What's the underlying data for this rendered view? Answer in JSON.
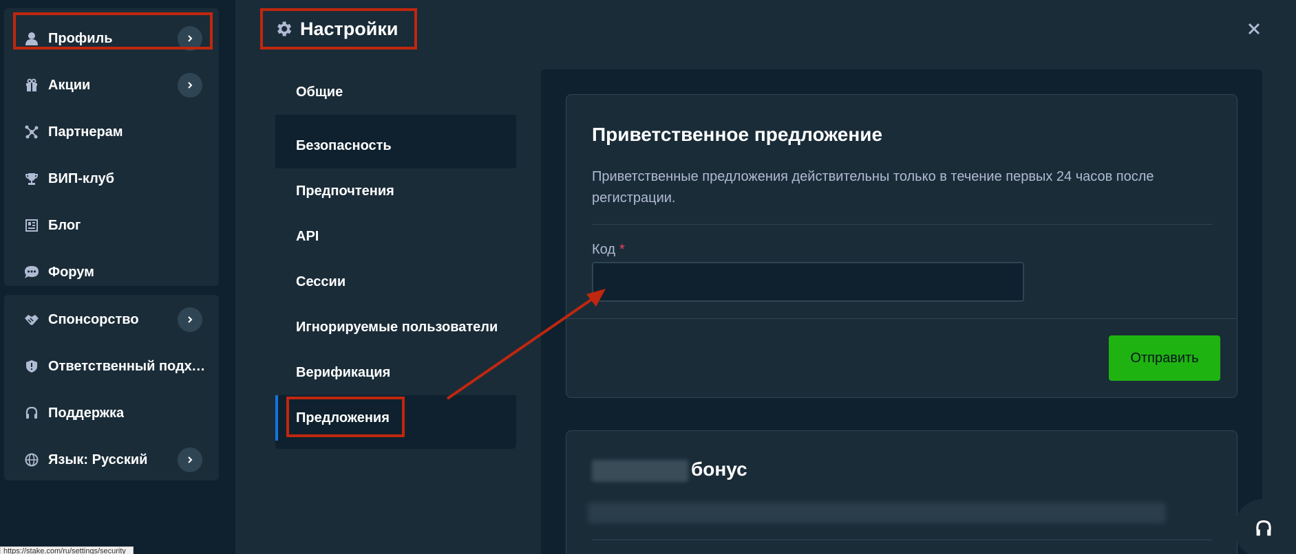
{
  "sidebar": {
    "items": [
      {
        "label": "Профиль",
        "icon": "user-icon"
      },
      {
        "label": "Акции",
        "icon": "gift-icon"
      },
      {
        "label": "Партнерам",
        "icon": "affiliate-icon"
      },
      {
        "label": "ВИП-клуб",
        "icon": "trophy-icon"
      },
      {
        "label": "Блог",
        "icon": "blog-icon"
      },
      {
        "label": "Форум",
        "icon": "chat-icon"
      },
      {
        "label": "Спонсорство",
        "icon": "handshake-icon"
      },
      {
        "label": "Ответственный подхо...",
        "icon": "shield-icon"
      },
      {
        "label": "Поддержка",
        "icon": "headset-icon"
      },
      {
        "label": "Язык: Русский",
        "icon": "globe-icon"
      }
    ]
  },
  "header": {
    "title": "Настройки",
    "icon": "gear-icon"
  },
  "settings_menu": {
    "items": [
      "Общие",
      "Безопасность",
      "Предпочтения",
      "API",
      "Сессии",
      "Игнорируемые пользователи",
      "Верификация",
      "Предложения"
    ],
    "active": "Предложения"
  },
  "welcome_offer": {
    "title": "Приветственное предложение",
    "description": "Приветственные предложения действительны только в течение первых 24 часов после регистрации.",
    "code_label": "Код",
    "required_mark": "*",
    "code_value": "",
    "submit_label": "Отправить"
  },
  "bonus_card": {
    "title": "бонус"
  },
  "status_bar": {
    "url": "https://stake.com/ru/settings/security"
  },
  "colors": {
    "background": "#1a2c38",
    "sidebar": "#0f212e",
    "submit_green": "#1fb312",
    "highlight_red": "#c0270f",
    "active_blue": "#1475e1",
    "required_red": "#ed4163"
  }
}
